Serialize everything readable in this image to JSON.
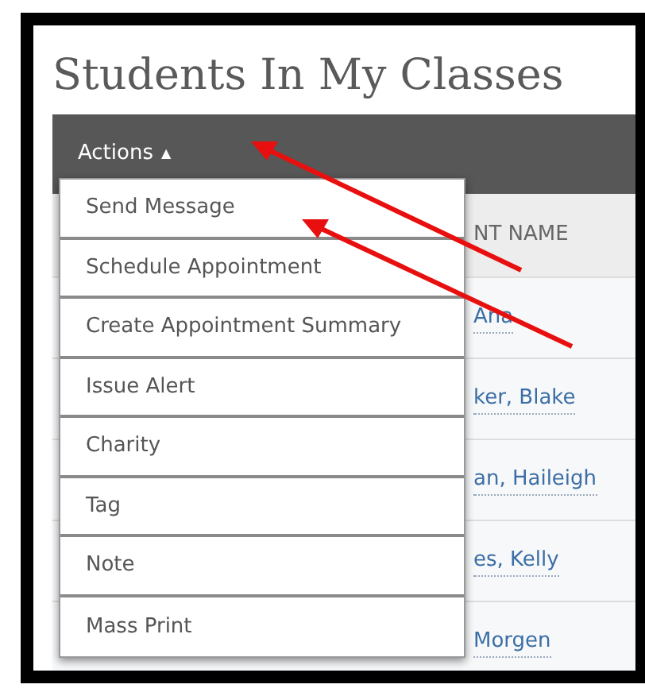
{
  "page_title": "Students In My Classes",
  "actions_menu": {
    "label": "Actions",
    "caret": "▲",
    "expanded": true,
    "items": [
      {
        "label": "Send Message"
      },
      {
        "label": "Schedule Appointment"
      },
      {
        "label": "Create Appointment Summary"
      },
      {
        "label": "Issue Alert"
      },
      {
        "label": "Charity"
      },
      {
        "label": "Tag"
      },
      {
        "label": "Note"
      },
      {
        "label": "Mass Print"
      }
    ]
  },
  "table": {
    "columns": [
      "NT NAME"
    ],
    "rows": [
      {
        "name": "Ana"
      },
      {
        "name": "ker, Blake"
      },
      {
        "name": "an, Haileigh"
      },
      {
        "name": "es, Kelly"
      },
      {
        "name": "Morgen"
      }
    ]
  }
}
